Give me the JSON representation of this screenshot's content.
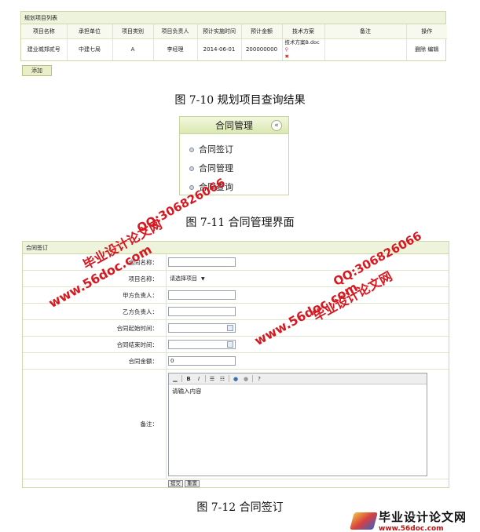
{
  "project_list": {
    "title": "规划项目列表",
    "columns": [
      "项目名称",
      "承担单位",
      "项目类别",
      "项目负责人",
      "预计实施时间",
      "预计金额",
      "技术方案",
      "备注",
      "操作"
    ],
    "rows": [
      {
        "name": "建业城郑贰号",
        "unit": "中建七局",
        "category": "A",
        "owner": "李经理",
        "start_date": "2014-06-01",
        "amount": "200000000",
        "plan_file": "技术方案B.doc",
        "remark": "",
        "op_delete": "删除",
        "op_edit": "编辑"
      }
    ],
    "add_button": "添加"
  },
  "captions": {
    "fig10": "图 7-10 规划项目查询结果",
    "fig11": "图 7-11 合同管理界面",
    "fig12": "图 7-12 合同签订"
  },
  "menu": {
    "title": "合同管理",
    "items": [
      "合同签订",
      "合同管理",
      "合同查询"
    ]
  },
  "contract_form": {
    "title": "合同签订",
    "fields": {
      "contract_name": "合同名称：",
      "project_name": "项目名称：",
      "party_a": "甲方负责人：",
      "party_b": "乙方负责人：",
      "start_time": "合同起始时间：",
      "end_time": "合同结束时间：",
      "amount": "合同金额：",
      "remark": "备注："
    },
    "project_select": "请选择项目",
    "amount_value": "0",
    "editor_placeholder": "请输入内容",
    "submit_button": "提交",
    "reset_button": "重置"
  },
  "watermarks": {
    "site_name": "毕业设计论文网",
    "url": "www.56doc.com",
    "qq": "QQ:306826066"
  },
  "footer": {
    "name": "毕业设计论文网",
    "url": "www.56doc.com"
  }
}
